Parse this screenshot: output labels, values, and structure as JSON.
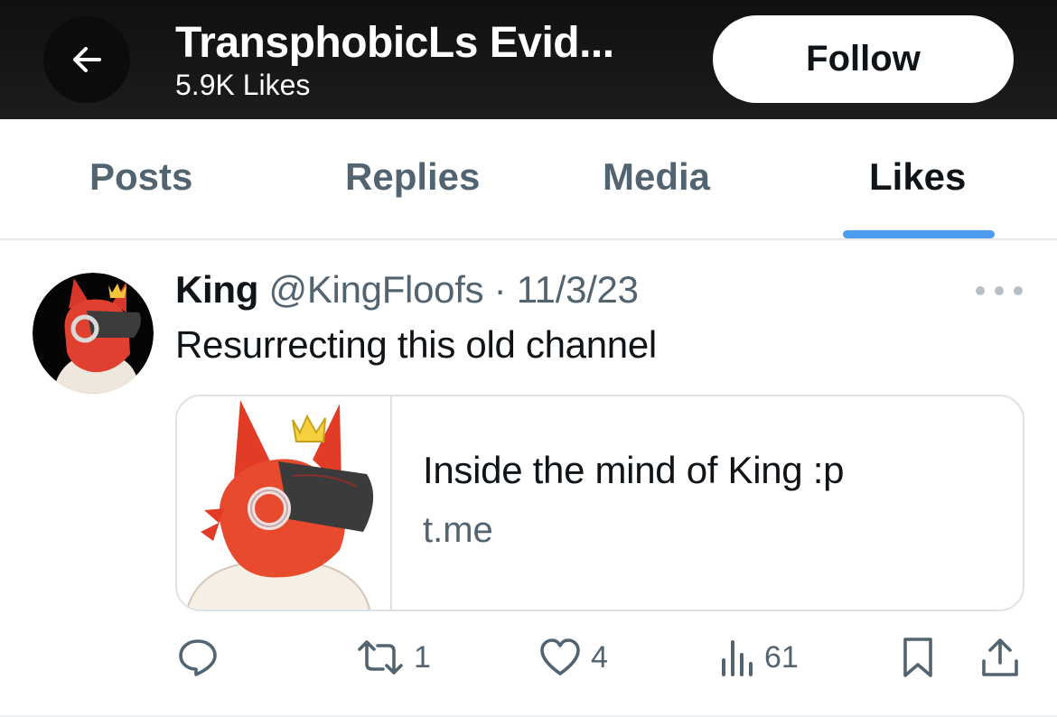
{
  "header": {
    "title": "TransphobicLs Evid...",
    "subtitle": "5.9K Likes",
    "follow_label": "Follow",
    "back_icon": "arrow-left-icon"
  },
  "tabs": [
    {
      "label": "Posts",
      "active": false
    },
    {
      "label": "Replies",
      "active": false
    },
    {
      "label": "Media",
      "active": false
    },
    {
      "label": "Likes",
      "active": true
    }
  ],
  "tweet": {
    "author_name": "King",
    "author_handle": "@KingFloofs",
    "separator": "·",
    "date": "11/3/23",
    "text": "Resurrecting this old channel",
    "card": {
      "title": "Inside the mind of King :p",
      "domain": "t.me"
    },
    "actions": {
      "reply_count": "",
      "retweet_count": "1",
      "like_count": "4",
      "view_count": "61"
    }
  },
  "colors": {
    "accent": "#4e9cf0",
    "muted_text": "#536471",
    "header_bg": "#161616"
  }
}
